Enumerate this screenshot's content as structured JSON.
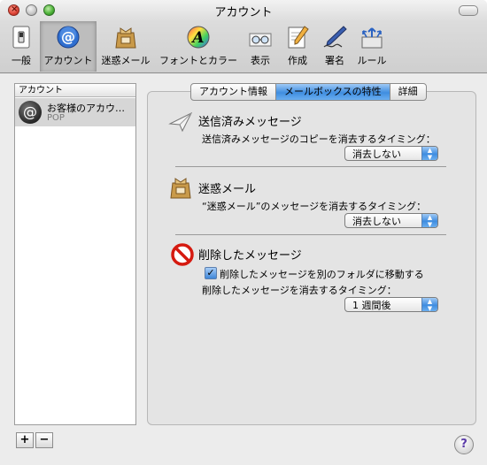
{
  "window": {
    "title": "アカウント"
  },
  "toolbar": {
    "items": [
      {
        "label": "一般",
        "icon": "light-switch-icon"
      },
      {
        "label": "アカウント",
        "icon": "at-sign-icon",
        "selected": true
      },
      {
        "label": "迷惑メール",
        "icon": "junk-mail-bag-icon"
      },
      {
        "label": "フォントとカラー",
        "icon": "font-color-icon"
      },
      {
        "label": "表示",
        "icon": "glasses-icon"
      },
      {
        "label": "作成",
        "icon": "pencil-paper-icon"
      },
      {
        "label": "署名",
        "icon": "pen-signature-icon"
      },
      {
        "label": "ルール",
        "icon": "rules-arrows-icon"
      }
    ]
  },
  "accounts": {
    "header": "アカウント",
    "items": [
      {
        "name": "お客様のアカウ…",
        "type": "POP",
        "icon": "at-sign-icon"
      }
    ],
    "add_label": "+",
    "remove_label": "−"
  },
  "tabs": [
    {
      "label": "アカウント情報",
      "active": false
    },
    {
      "label": "メールボックスの特性",
      "active": true
    },
    {
      "label": "詳細",
      "active": false
    }
  ],
  "sections": {
    "sent": {
      "title": "送信済みメッセージ",
      "icon": "paper-plane-icon",
      "label": "送信済みメッセージのコピーを消去するタイミング：",
      "popup_value": "消去しない"
    },
    "junk": {
      "title": "迷惑メール",
      "icon": "junk-mail-bag-icon",
      "label": "“迷惑メール”のメッセージを消去するタイミング：",
      "popup_value": "消去しない"
    },
    "trash": {
      "title": "削除したメッセージ",
      "icon": "prohibited-icon",
      "checkbox_label": "削除したメッセージを別のフォルダに移動する",
      "checkbox_checked": true,
      "label": "削除したメッセージを消去するタイミング：",
      "popup_value": "1 週間後"
    }
  },
  "help": {
    "label": "?"
  },
  "colors": {
    "accent": "#3f8de0",
    "selected_row": "#d6d6d6"
  }
}
